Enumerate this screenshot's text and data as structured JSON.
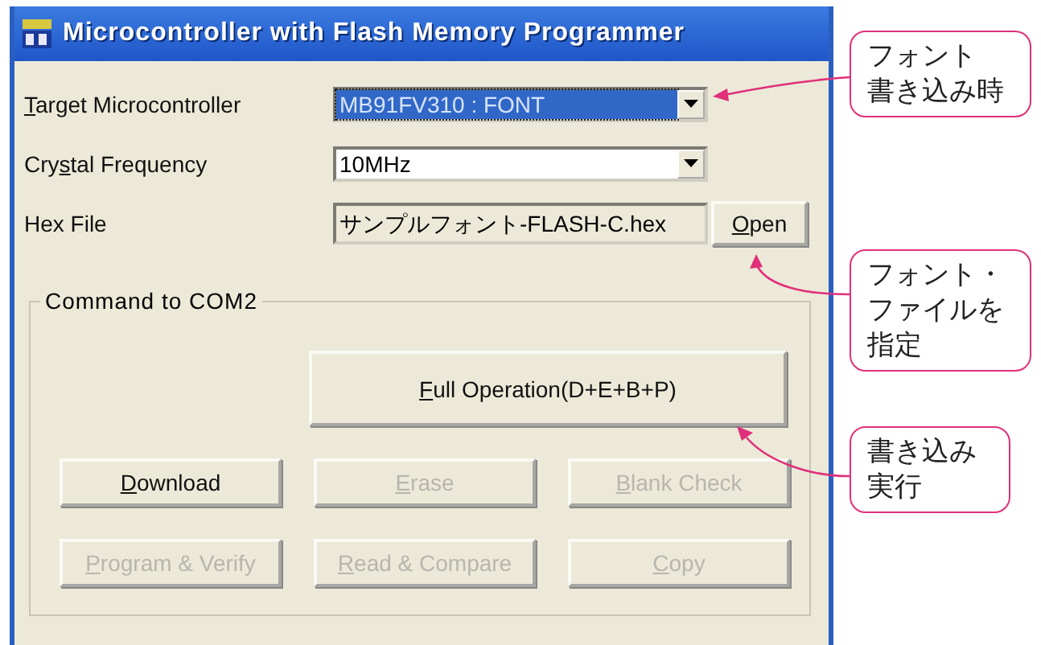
{
  "window": {
    "title": "Microcontroller with Flash Memory Programmer"
  },
  "fields": [
    {
      "kind": "dropdown",
      "label": {
        "key": "T",
        "after": "arget Microcontroller"
      },
      "value": "MB91FV310 : FONT",
      "focused": true
    },
    {
      "kind": "dropdown",
      "label": {
        "before": "Cry",
        "key": "s",
        "after": "tal Frequency"
      },
      "value": "10MHz",
      "focused": false
    },
    {
      "kind": "file",
      "label": {
        "after": "Hex File"
      },
      "value": "サンプルフォント-FLASH-C.hex",
      "button": {
        "label": {
          "key": "O",
          "after": "pen"
        }
      }
    }
  ],
  "group": {
    "title": "Command to COM2",
    "main_button": {
      "label": {
        "key": "F",
        "after": "ull Operation(D+E+B+P)"
      },
      "disabled": false
    },
    "buttons": [
      {
        "label": {
          "key": "D",
          "after": "ownload"
        },
        "disabled": false
      },
      {
        "label": {
          "key": "E",
          "after": "rase"
        },
        "disabled": true
      },
      {
        "label": {
          "key": "B",
          "after": "lank Check"
        },
        "disabled": true
      },
      {
        "label": {
          "key": "P",
          "after": "rogram & Verify"
        },
        "disabled": true
      },
      {
        "label": {
          "key": "R",
          "after": "ead & Compare"
        },
        "disabled": true
      },
      {
        "label": {
          "key": "C",
          "after": "opy"
        },
        "disabled": true
      }
    ]
  },
  "callouts": [
    {
      "lines": [
        "フォント",
        "書き込み時"
      ]
    },
    {
      "lines": [
        "フォント・",
        "ファイルを",
        "指定"
      ]
    },
    {
      "lines": [
        "書き込み",
        "実行"
      ]
    }
  ]
}
